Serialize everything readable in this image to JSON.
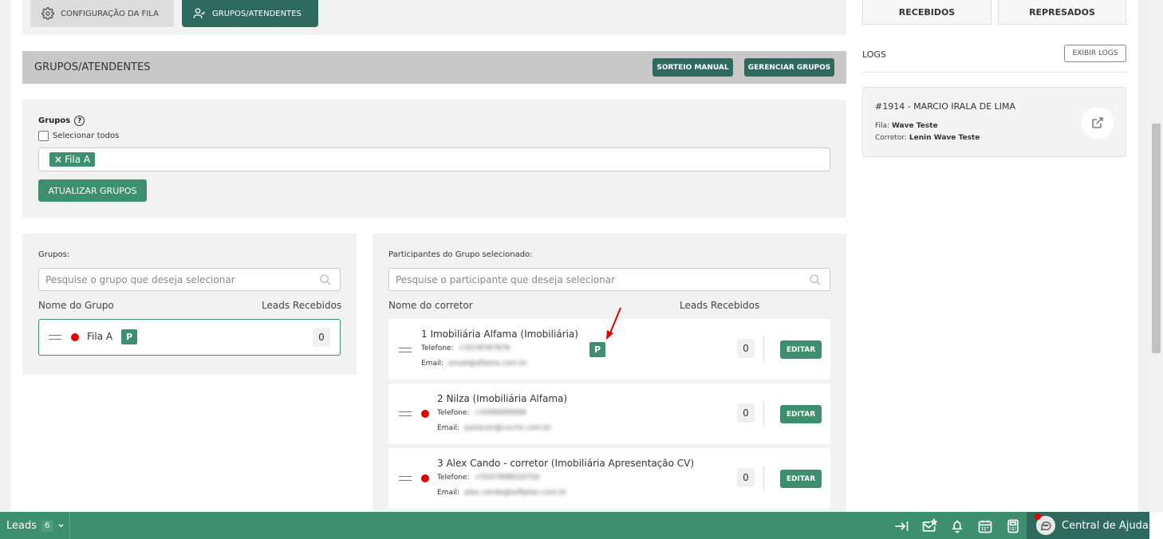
{
  "tabs": {
    "config_label": "CONFIGURAÇÃO DA FILA",
    "grupos_label": "GRUPOS/ATENDENTES"
  },
  "section": {
    "title": "GRUPOS/ATENDENTES",
    "sorteio_label": "SORTEIO MANUAL",
    "gerenciar_label": "GERENCIAR GRUPOS"
  },
  "groups_filter": {
    "label": "Grupos",
    "help": "?",
    "select_all_label": "Selecionar todos",
    "chip_label": "Fila A",
    "chip_remove": "×",
    "update_label": "ATUALIZAR GRUPOS"
  },
  "groups_panel": {
    "label": "Grupos:",
    "search_placeholder": "Pesquise o grupo que deseja selecionar",
    "col_name": "Nome do Grupo",
    "col_leads": "Leads Recebidos",
    "rows": [
      {
        "name": "Fila A",
        "badge": "P",
        "leads": "0"
      }
    ]
  },
  "participants_panel": {
    "label": "Participantes do Grupo selecionado:",
    "search_placeholder": "Pesquise o participante que deseja selecionar",
    "col_name": "Nome do corretor",
    "col_leads": "Leads Recebidos",
    "phone_label": "Telefone:",
    "email_label": "Email:",
    "edit_label": "EDITAR",
    "rows": [
      {
        "name": "1 Imobiliária Alfama (Imobiliária)",
        "phone": "+5578787878",
        "email": "email@alfama.com.br",
        "leads": "0",
        "badge": "P"
      },
      {
        "name": "2 Nilza (Imobiliária Alfama)",
        "phone": "+5599999999",
        "email": "justacon@cvcrm.com.br",
        "leads": "0"
      },
      {
        "name": "3 Alex Cando - corretor (Imobiliária Apresentação CV)",
        "phone": "+5547998020750",
        "email": "alex.cando@softplan.com.br",
        "leads": "0"
      }
    ]
  },
  "right_panel": {
    "recebidos_label": "RECEBIDOS",
    "represados_label": "REPRESADOS",
    "logs_label": "LOGS",
    "exibir_logs_label": "EXIBIR LOGS",
    "log": {
      "title": "#1914 - MARCIO IRALA DE LIMA",
      "fila_label": "Fila:",
      "fila_value": "Wave Teste",
      "corretor_label": "Corretor:",
      "corretor_value": "Lenin Wave Teste"
    }
  },
  "bottom_bar": {
    "leads_label": "Leads",
    "leads_count": "6",
    "help_label": "Central de Ajuda"
  },
  "colors": {
    "primary_dark": "#2e6b5e",
    "primary": "#3d8f6f",
    "status_offline": "#e00000"
  },
  "icons": [
    "gear-icon",
    "users-icon",
    "help-icon",
    "search-icon",
    "drag-handle-icon",
    "external-link-icon",
    "arrow-right-to-line-icon",
    "mail-star-icon",
    "bell-icon",
    "calendar-icon",
    "calculator-icon",
    "chat-icon",
    "chevron-down-icon"
  ]
}
